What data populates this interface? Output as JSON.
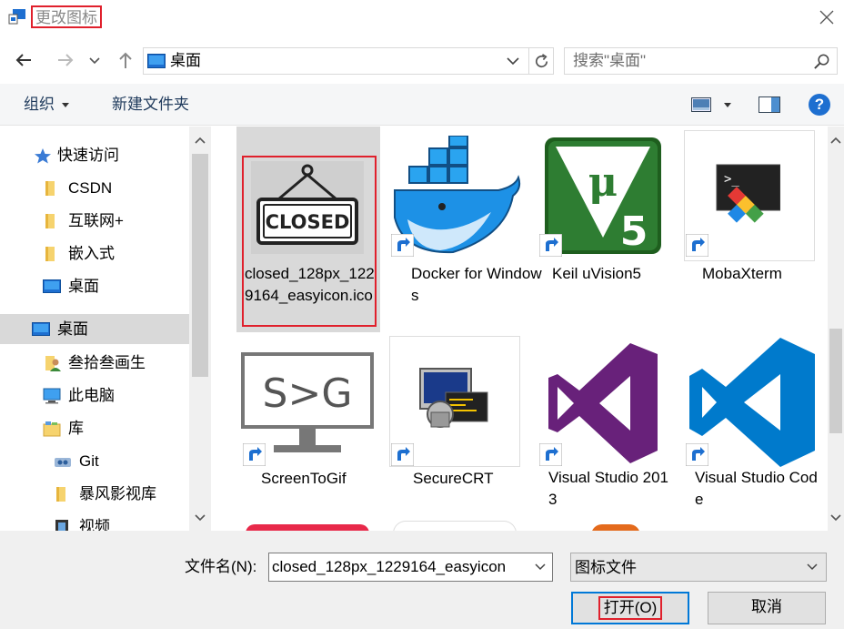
{
  "window": {
    "title": "更改图标"
  },
  "nav": {
    "address": "桌面",
    "search_placeholder": "搜索\"桌面\""
  },
  "toolbar": {
    "organize_label": "组织",
    "new_folder_label": "新建文件夹"
  },
  "sidebar": {
    "items": [
      {
        "label": "快速访问",
        "icon": "star-icon"
      },
      {
        "label": "CSDN",
        "icon": "folder-icon"
      },
      {
        "label": "互联网+",
        "icon": "folder-icon"
      },
      {
        "label": "嵌入式",
        "icon": "folder-icon"
      },
      {
        "label": "桌面",
        "icon": "desktop-icon"
      },
      {
        "label": "桌面",
        "icon": "desktop-icon"
      },
      {
        "label": "叁拾叁画生",
        "icon": "user-folder-icon"
      },
      {
        "label": "此电脑",
        "icon": "computer-icon"
      },
      {
        "label": "库",
        "icon": "library-icon"
      },
      {
        "label": "Git",
        "icon": "git-icon"
      },
      {
        "label": "暴风影视库",
        "icon": "folder-icon"
      },
      {
        "label": "视频",
        "icon": "video-icon"
      }
    ]
  },
  "files": [
    {
      "label": "closed_128px_1229164_easyicon.ico",
      "icon": "closed-sign-icon"
    },
    {
      "label": "Docker for Windows",
      "icon": "docker-icon"
    },
    {
      "label": "Keil uVision5",
      "icon": "keil-icon"
    },
    {
      "label": "MobaXterm",
      "icon": "mobaxterm-icon"
    },
    {
      "label": "ScreenToGif",
      "icon": "screentogif-icon"
    },
    {
      "label": "SecureCRT",
      "icon": "securecrt-icon"
    },
    {
      "label": "Visual Studio 2013",
      "icon": "visual-studio-2013-icon"
    },
    {
      "label": "Visual Studio Code",
      "icon": "vscode-icon"
    }
  ],
  "closed_sign_text": "CLOSED",
  "screentogif_text": "S>G",
  "keil_text": {
    "mu": "μ",
    "five": "5"
  },
  "mobaxterm_prompt": ">_",
  "bottom": {
    "filename_label": "文件名(N):",
    "filename_value": "closed_128px_1229164_easyicon",
    "filetype_value": "图标文件",
    "open_label": "打开(O)",
    "cancel_label": "取消"
  },
  "colors": {
    "highlight_red": "#e0202c",
    "selection_gray": "#d9d9d9",
    "accent_blue": "#0078d7",
    "docker_blue": "#1d91e6",
    "keil_green": "#2e7d32",
    "vs_purple": "#68217a",
    "vscode_blue": "#007acc"
  }
}
